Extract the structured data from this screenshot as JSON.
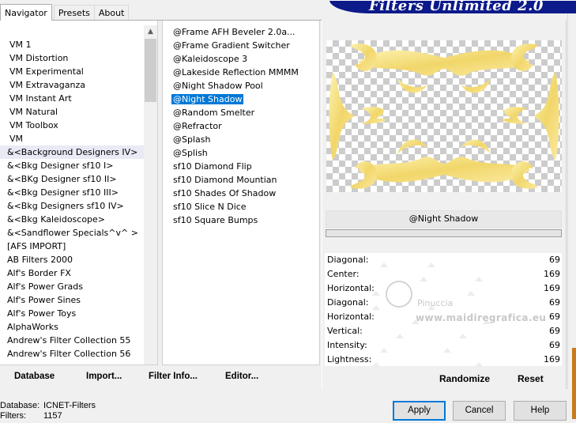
{
  "tabs": [
    {
      "label": "Navigator"
    },
    {
      "label": "Presets"
    },
    {
      "label": "About"
    }
  ],
  "app_title": "Filters Unlimited 2.0",
  "categories": [
    {
      "label": "VM 1"
    },
    {
      "label": "VM Distortion"
    },
    {
      "label": "VM Experimental"
    },
    {
      "label": "VM Extravaganza"
    },
    {
      "label": "VM Instant Art"
    },
    {
      "label": "VM Natural"
    },
    {
      "label": "VM Toolbox"
    },
    {
      "label": "VM"
    },
    {
      "label": "&<Background Designers IV>"
    },
    {
      "label": "&<Bkg Designer sf10 I>"
    },
    {
      "label": "&<BKg Designer sf10 II>"
    },
    {
      "label": "&<Bkg Designer sf10 III>"
    },
    {
      "label": "&<Bkg Designers sf10 IV>"
    },
    {
      "label": "&<Bkg Kaleidoscope>"
    },
    {
      "label": "&<Sandflower Specials^v^ >"
    },
    {
      "label": "[AFS IMPORT]"
    },
    {
      "label": "AB Filters 2000"
    },
    {
      "label": "Alf's Border FX"
    },
    {
      "label": "Alf's Power Grads"
    },
    {
      "label": "Alf's Power Sines"
    },
    {
      "label": "Alf's Power Toys"
    },
    {
      "label": "AlphaWorks"
    },
    {
      "label": "Andrew's Filter Collection 55"
    },
    {
      "label": "Andrew's Filter Collection 56"
    }
  ],
  "filters": [
    {
      "label": "@Frame AFH Beveler 2.0a..."
    },
    {
      "label": "@Frame Gradient Switcher"
    },
    {
      "label": "@Kaleidoscope 3"
    },
    {
      "label": "@Lakeside Reflection MMMM"
    },
    {
      "label": "@Night Shadow Pool"
    },
    {
      "label": "@Night Shadow"
    },
    {
      "label": "@Random Smelter"
    },
    {
      "label": "@Refractor"
    },
    {
      "label": "@Splash"
    },
    {
      "label": "@Splish"
    },
    {
      "label": "sf10 Diamond Flip"
    },
    {
      "label": "sf10 Diamond Mountian"
    },
    {
      "label": "sf10 Shades Of Shadow"
    },
    {
      "label": "sf10 Slice N Dice"
    },
    {
      "label": "sf10 Square Bumps"
    }
  ],
  "selected_filter_index": 5,
  "selected_filter_name": "@Night Shadow",
  "bottom_links": {
    "database": "Database",
    "import": "Import...",
    "filter_info": "Filter Info...",
    "editor": "Editor..."
  },
  "params": [
    {
      "label": "Diagonal:",
      "value": "69"
    },
    {
      "label": "Center:",
      "value": "169"
    },
    {
      "label": "Horizontal:",
      "value": "169"
    },
    {
      "label": "Diagonal:",
      "value": "69"
    },
    {
      "label": "Horizontal:",
      "value": "69"
    },
    {
      "label": "Vertical:",
      "value": "69"
    },
    {
      "label": "Intensity:",
      "value": "69"
    },
    {
      "label": "Lightness:",
      "value": "169"
    }
  ],
  "watermark": {
    "name": "Pinuccia",
    "site": "www.maidiregrafica.eu"
  },
  "randomize_label": "Randomize",
  "reset_label": "Reset",
  "status": {
    "database_key": "Database:",
    "database_value": "ICNET-Filters",
    "filters_key": "Filters:",
    "filters_value": "1157"
  },
  "buttons": {
    "apply": "Apply",
    "cancel": "Cancel",
    "help": "Help"
  },
  "colors": {
    "selection": "#0078d7",
    "banner": "#0c1a8a",
    "preview_gold": "#f3de84"
  }
}
